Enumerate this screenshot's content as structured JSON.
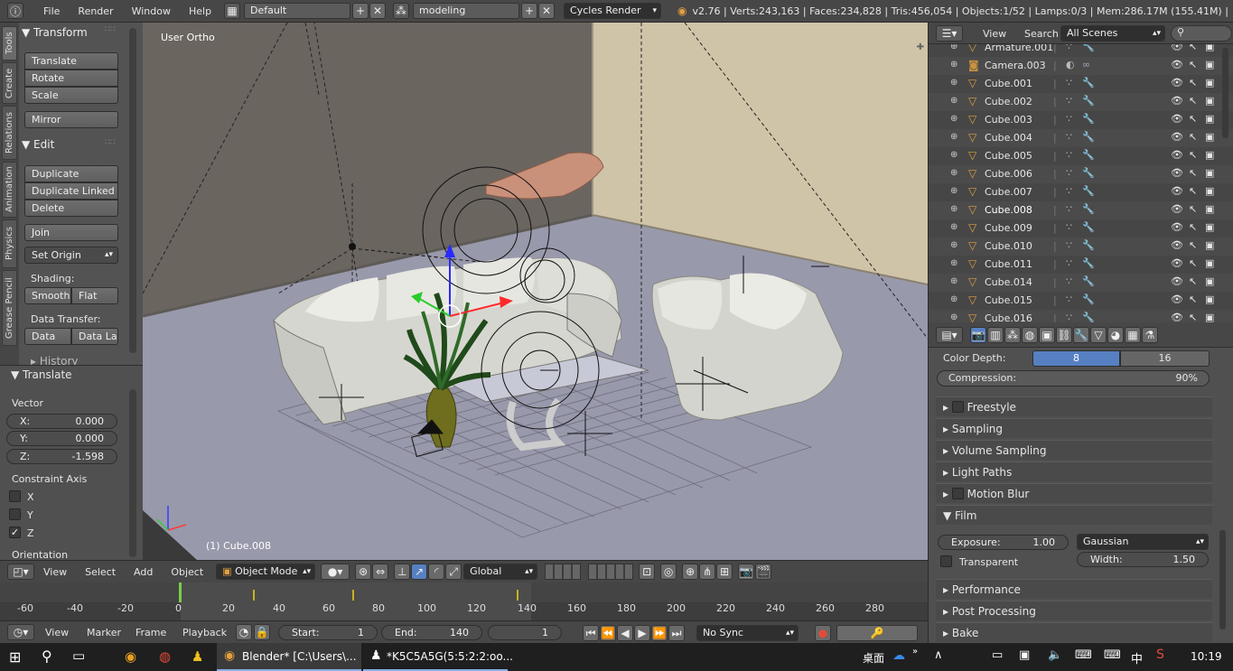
{
  "menubar": {
    "items": [
      "File",
      "Render",
      "Window",
      "Help"
    ],
    "layout": "Default",
    "scene": "modeling",
    "engine": "Cycles Render",
    "stats": "v2.76 | Verts:243,163 | Faces:234,828 | Tris:456,054 | Objects:1/52 | Lamps:0/3 | Mem:286.17M (155.41M) |"
  },
  "tools": {
    "tabs": [
      "Tools",
      "Create",
      "Relations",
      "Animation",
      "Physics",
      "Grease Pencil"
    ],
    "transform_title": "Transform",
    "translate": "Translate",
    "rotate": "Rotate",
    "scale": "Scale",
    "mirror": "Mirror",
    "edit_title": "Edit",
    "duplicate": "Duplicate",
    "duplicate_linked": "Duplicate Linked",
    "delete": "Delete",
    "join": "Join",
    "set_origin": "Set Origin",
    "shading_label": "Shading:",
    "smooth": "Smooth",
    "flat": "Flat",
    "data_transfer_label": "Data Transfer:",
    "data": "Data",
    "data_la": "Data La",
    "history": "History"
  },
  "operator": {
    "title": "Translate",
    "vector_label": "Vector",
    "x_label": "X:",
    "x": "0.000",
    "y_label": "Y:",
    "y": "0.000",
    "z_label": "Z:",
    "z": "-1.598",
    "constraint_label": "Constraint Axis",
    "cx": "X",
    "cy": "Y",
    "cz": "Z",
    "orientation_label": "Orientation"
  },
  "viewport": {
    "view_label": "User Ortho",
    "object_label": "(1) Cube.008"
  },
  "viewheader": {
    "view": "View",
    "select": "Select",
    "add": "Add",
    "object": "Object",
    "mode": "Object Mode",
    "orientation": "Global"
  },
  "timeline": {
    "ticks": [
      "-60",
      "-40",
      "-20",
      "0",
      "20",
      "40",
      "60",
      "80",
      "100",
      "120",
      "140",
      "160",
      "180",
      "200",
      "220",
      "240",
      "260",
      "280"
    ],
    "view": "View",
    "marker": "Marker",
    "frame": "Frame",
    "playback": "Playback",
    "start_label": "Start:",
    "start": "1",
    "end_label": "End:",
    "end": "140",
    "current": "1",
    "sync": "No Sync"
  },
  "outliner": {
    "view": "View",
    "search": "Search",
    "scenes": "All Scenes",
    "rows": [
      "Armature.001",
      "Camera.003",
      "Cube.001",
      "Cube.002",
      "Cube.003",
      "Cube.004",
      "Cube.005",
      "Cube.006",
      "Cube.007",
      "Cube.008",
      "Cube.009",
      "Cube.010",
      "Cube.011",
      "Cube.014",
      "Cube.015",
      "Cube.016"
    ],
    "selected": "Cube.008"
  },
  "properties": {
    "color_depth_label": "Color Depth:",
    "depth_8": "8",
    "depth_16": "16",
    "compression_label": "Compression:",
    "compression": "90%",
    "panels": [
      "Freestyle",
      "Sampling",
      "Volume Sampling",
      "Light Paths",
      "Motion Blur",
      "Film",
      "Performance",
      "Post Processing",
      "Bake"
    ],
    "exposure_label": "Exposure:",
    "exposure": "1.00",
    "filter": "Gaussian",
    "transparent": "Transparent",
    "width_label": "Width:",
    "width": "1.50"
  },
  "taskbar": {
    "blender_task": "Blender* [C:\\Users\\...",
    "qq_task": "*K5C5A5G(5:5:2:2:oo...",
    "desktop": "桌面",
    "ime": "中",
    "clock": "10:19"
  },
  "colors": {
    "accent": "#5680c2",
    "selected_text": "#ffffff",
    "panel_bg": "#505050"
  }
}
